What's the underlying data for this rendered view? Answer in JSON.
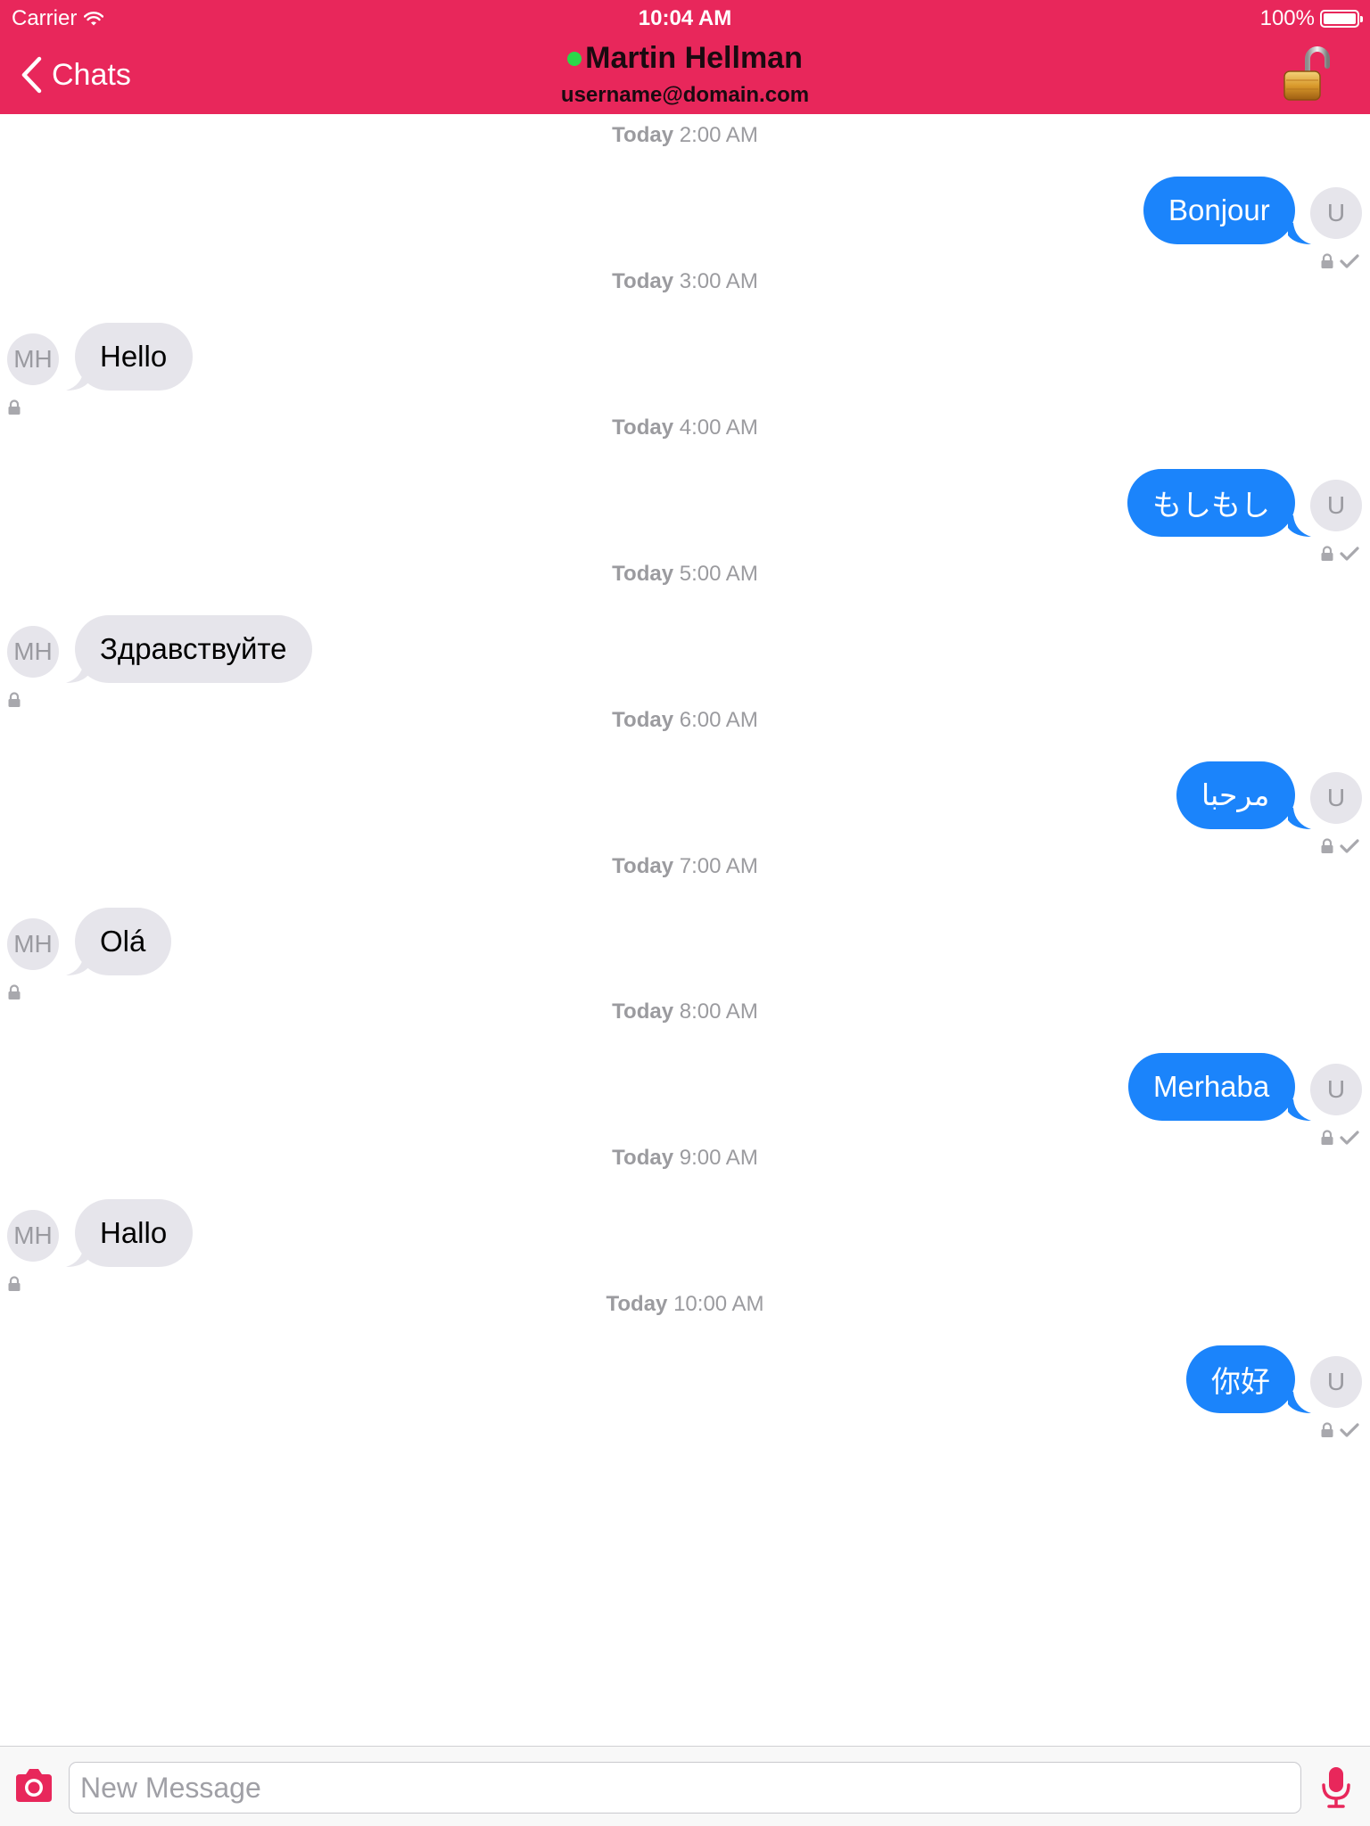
{
  "status_bar": {
    "carrier": "Carrier",
    "time": "10:04 AM",
    "battery": "100%",
    "battery_level": 1.0
  },
  "nav": {
    "back_label": "Chats",
    "contact_name": "Martin Hellman",
    "contact_subtitle": "username@domain.com",
    "online": true,
    "accent_color": "#e8275b",
    "online_color": "#2ad84a"
  },
  "thread": {
    "outgoing_color": "#1b84fb",
    "incoming_color": "#e6e5eb",
    "messages": [
      {
        "day": "Today",
        "time": "2:00 AM",
        "direction": "out",
        "text": "Bonjour",
        "avatar": "U"
      },
      {
        "day": "Today",
        "time": "3:00 AM",
        "direction": "in",
        "text": "Hello",
        "avatar": "MH"
      },
      {
        "day": "Today",
        "time": "4:00 AM",
        "direction": "out",
        "text": "もしもし",
        "avatar": "U"
      },
      {
        "day": "Today",
        "time": "5:00 AM",
        "direction": "in",
        "text": "Здравствуйте",
        "avatar": "MH"
      },
      {
        "day": "Today",
        "time": "6:00 AM",
        "direction": "out",
        "text": "مرحبا",
        "avatar": "U"
      },
      {
        "day": "Today",
        "time": "7:00 AM",
        "direction": "in",
        "text": "Olá",
        "avatar": "MH"
      },
      {
        "day": "Today",
        "time": "8:00 AM",
        "direction": "out",
        "text": "Merhaba",
        "avatar": "U"
      },
      {
        "day": "Today",
        "time": "9:00 AM",
        "direction": "in",
        "text": "Hallo",
        "avatar": "MH"
      },
      {
        "day": "Today",
        "time": "10:00 AM",
        "direction": "out",
        "text": "你好",
        "avatar": "U"
      }
    ]
  },
  "composer": {
    "placeholder": "New Message",
    "value": ""
  },
  "icons": {
    "back": "chevron-left-icon",
    "lock": "open-padlock-icon",
    "camera": "camera-icon",
    "mic": "microphone-icon",
    "encrypted": "lock-icon",
    "delivered": "checkmark-icon"
  }
}
